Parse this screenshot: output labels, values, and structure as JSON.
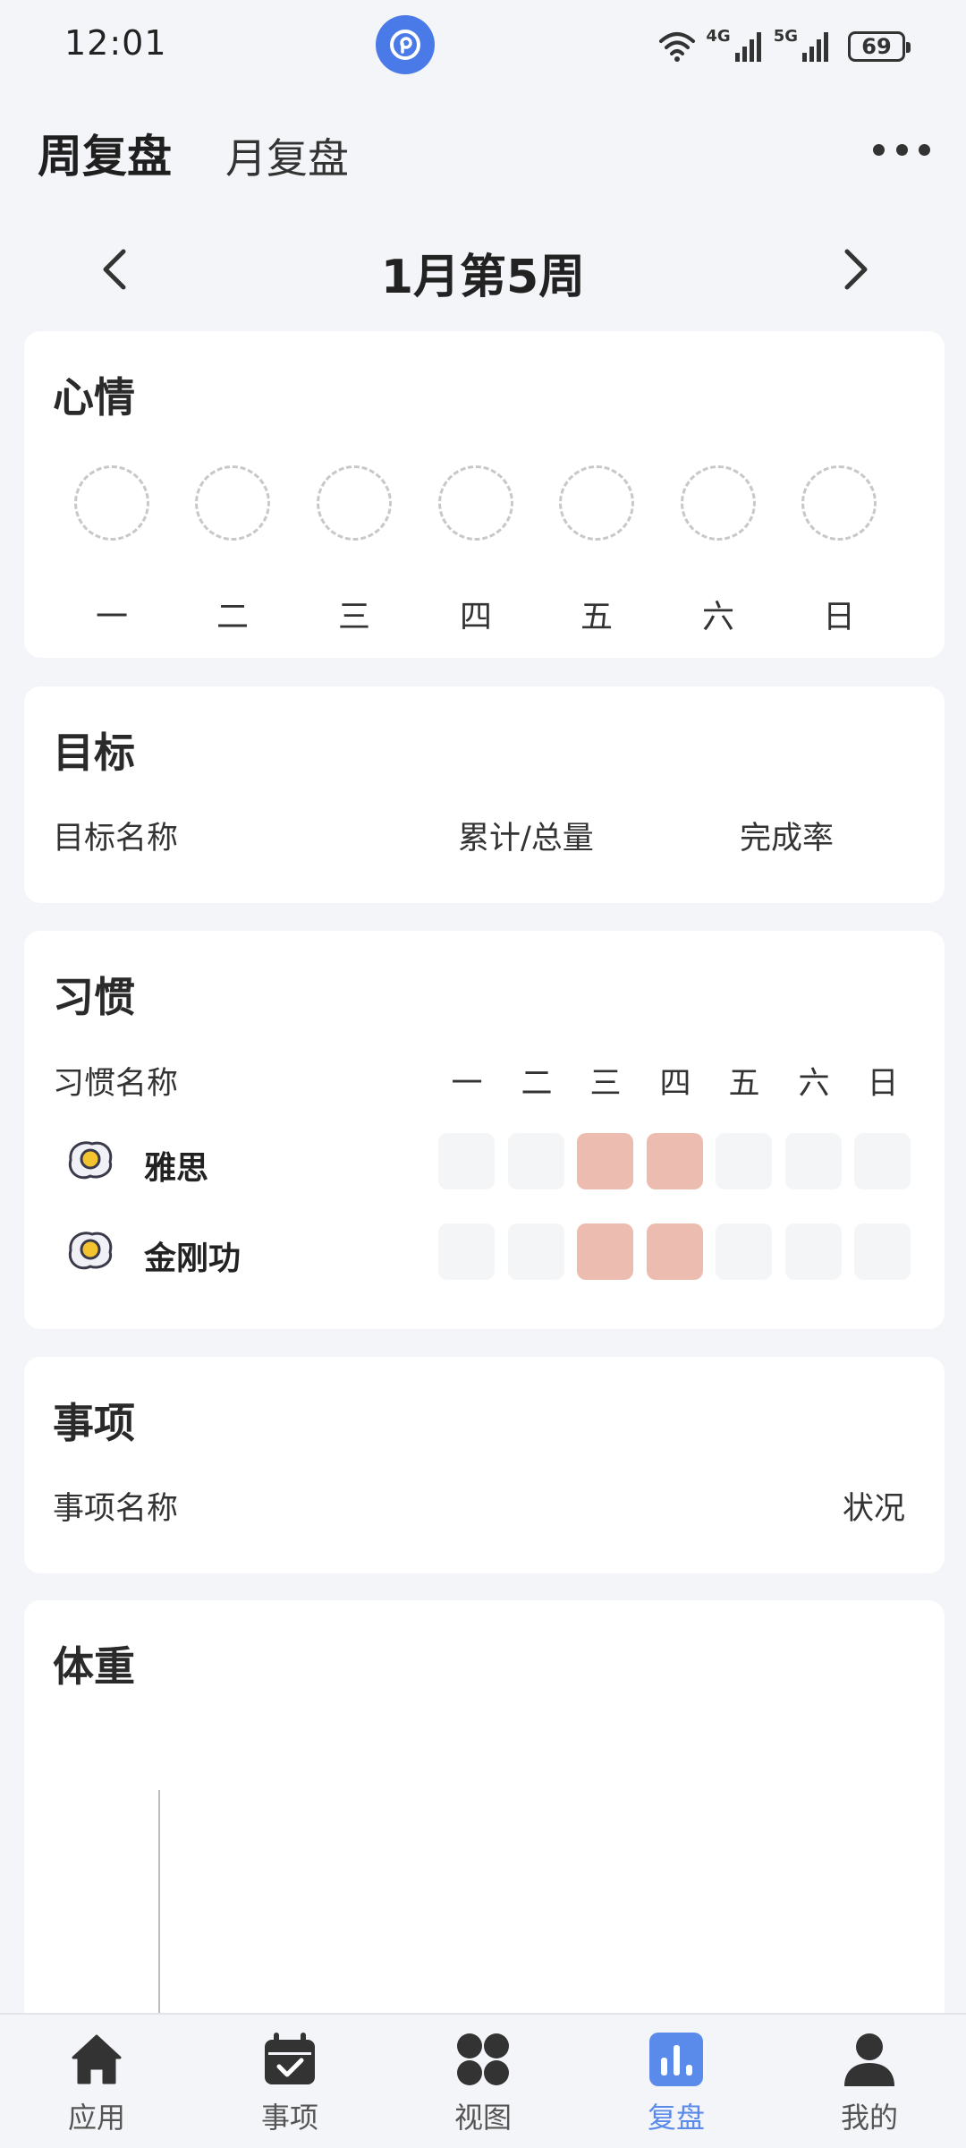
{
  "status_bar": {
    "time": "12:01",
    "net1": "4G",
    "net2": "5G",
    "battery": "69"
  },
  "header": {
    "tab_week": "周复盘",
    "tab_month": "月复盘"
  },
  "week_nav": {
    "title": "1月第5周"
  },
  "mood": {
    "title": "心情",
    "days": [
      "一",
      "二",
      "三",
      "四",
      "五",
      "六",
      "日"
    ]
  },
  "goals": {
    "title": "目标",
    "col_name": "目标名称",
    "col_total": "累计/总量",
    "col_rate": "完成率"
  },
  "habits": {
    "title": "习惯",
    "col_name": "习惯名称",
    "days": [
      "一",
      "二",
      "三",
      "四",
      "五",
      "六",
      "日"
    ],
    "rows": [
      {
        "name": "雅思",
        "done": [
          false,
          false,
          true,
          true,
          false,
          false,
          false
        ]
      },
      {
        "name": "金刚功",
        "done": [
          false,
          false,
          true,
          true,
          false,
          false,
          false
        ]
      }
    ],
    "done_color": "#edbcb0"
  },
  "tasks": {
    "title": "事项",
    "col_name": "事项名称",
    "col_status": "状况"
  },
  "weight": {
    "title": "体重"
  },
  "bottom_nav": {
    "items": [
      {
        "label": "应用",
        "icon": "home-icon"
      },
      {
        "label": "事项",
        "icon": "calendar-check-icon"
      },
      {
        "label": "视图",
        "icon": "grid-icon"
      },
      {
        "label": "复盘",
        "icon": "bar-chart-icon",
        "active": true
      },
      {
        "label": "我的",
        "icon": "user-icon"
      }
    ],
    "active_color": "#5b8bea"
  }
}
